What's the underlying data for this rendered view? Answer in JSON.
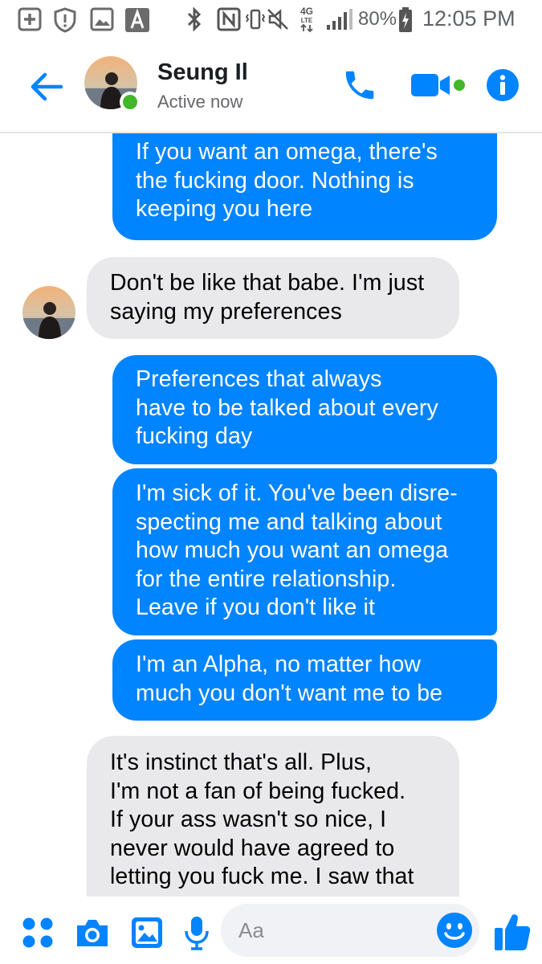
{
  "status_bar": {
    "battery_percent": "80%",
    "time": "12:05 PM",
    "network_label": "4G LTE",
    "notification_icons": [
      "plus-box-icon",
      "shield-alert-icon",
      "image-icon",
      "text-a-icon"
    ],
    "system_icons": [
      "bluetooth-icon",
      "nfc-icon",
      "vibrate-icon",
      "mute-icon",
      "signal-icon",
      "battery-icon"
    ]
  },
  "header": {
    "contact_name": "Seung Il",
    "contact_status": "Active now",
    "accent_color": "#0084ff",
    "presence_color": "#42b72a"
  },
  "messages": [
    {
      "direction": "sent",
      "text": "If you want an omega, there's\nthe fucking door. Nothing is\nkeeping you here"
    },
    {
      "direction": "received",
      "text": "Don't be like that babe. I'm just\nsaying my preferences"
    },
    {
      "direction": "sent",
      "text": "Preferences that always\nhave to be talked about every\nfucking day"
    },
    {
      "direction": "sent",
      "text": "I'm sick of it. You've been disre-\nspecting me and talking about\nhow much you want an omega\nfor the entire relationship.\nLeave if you don't like it"
    },
    {
      "direction": "sent",
      "text": "I'm an Alpha, no matter how\nmuch you don't want me to be"
    },
    {
      "direction": "received",
      "text": "It's instinct that's all. Plus,\nI'm not a fan of being fucked.\nIf your ass wasn't so nice, I\nnever would have agreed to\nletting you fuck me. I saw that"
    }
  ],
  "composer": {
    "placeholder": "Aa",
    "icons": [
      "apps-grid-icon",
      "camera-icon",
      "gallery-icon",
      "microphone-icon",
      "emoji-icon",
      "thumbs-up-icon"
    ],
    "sent_bubble_color": "#0084ff",
    "received_bubble_color": "#e9e9eb"
  }
}
